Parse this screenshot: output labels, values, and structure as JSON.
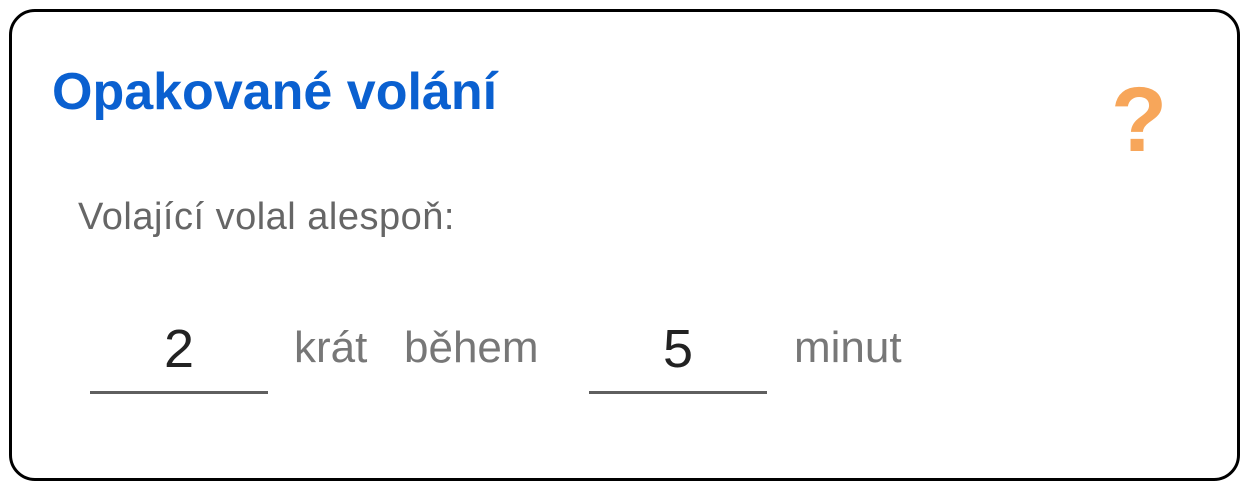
{
  "dialog": {
    "title": "Opakované volání",
    "help_icon": "question-mark-icon",
    "help_symbol": "?",
    "subtitle": "Volající volal alespoň:"
  },
  "form": {
    "times_value": "2",
    "times_label": "krát",
    "during_label": "během",
    "minutes_value": "5",
    "minutes_label": "minut"
  },
  "colors": {
    "title": "#0a60d0",
    "help_icon": "#f7a65a",
    "card_border": "#000000",
    "muted_text": "#666666"
  }
}
